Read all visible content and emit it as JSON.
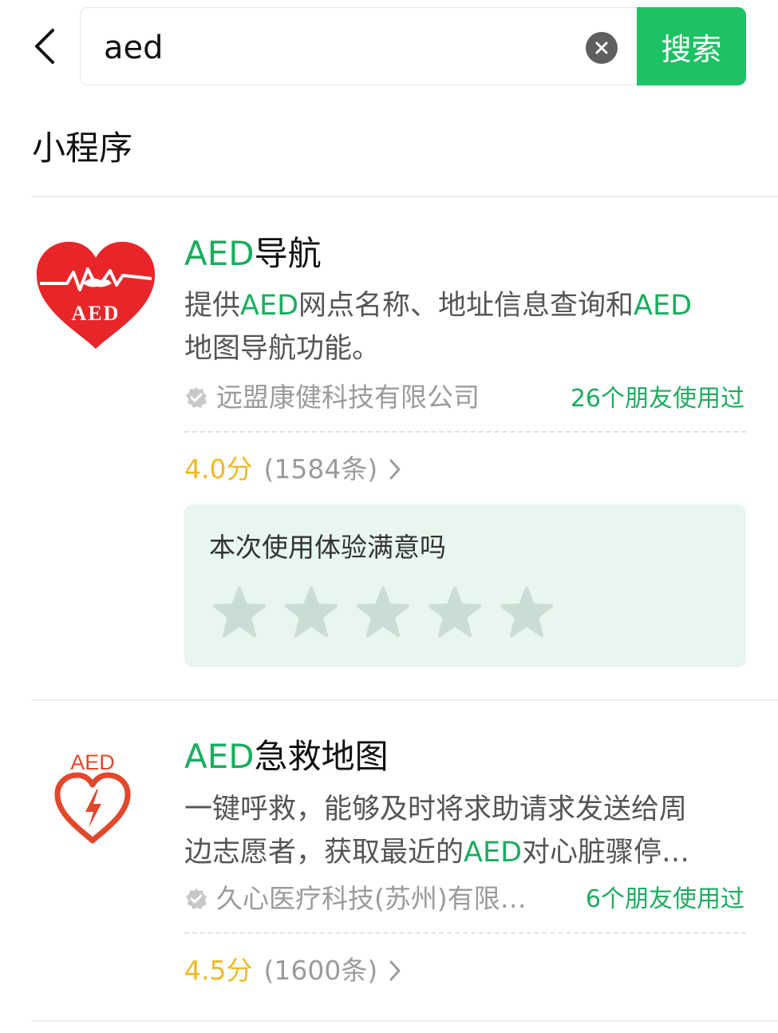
{
  "search": {
    "query": "aed",
    "button_label": "搜索"
  },
  "section": {
    "title": "小程序"
  },
  "results": [
    {
      "logo_text": "AED",
      "title_highlight": "AED",
      "title_rest": "导航",
      "desc_line1": [
        "提供",
        "AED",
        "网点名称、地址信息查询和",
        "AED"
      ],
      "desc_line2": "地图导航功能。",
      "developer": "远盟康健科技有限公司",
      "friends": "26个朋友使用过",
      "score": "4.0分",
      "count": "(1584条)"
    },
    {
      "logo_text": "AED",
      "title_highlight": "AED",
      "title_rest": "急救地图",
      "desc_line1": "一键呼救，能够及时将求助请求发送给周",
      "desc_line2": [
        "边志愿者，获取最近的",
        "AED",
        "对心脏骤停…"
      ],
      "developer": "久心医疗科技(苏州)有限…",
      "friends": "6个朋友使用过",
      "score": "4.5分",
      "count": "(1600条)"
    }
  ],
  "survey": {
    "question": "本次使用体验满意吗",
    "stars": 5
  },
  "colors": {
    "accent": "#1cc264",
    "highlight": "#1aad5e",
    "score": "#f2b824",
    "survey_bg": "#e7f6ee",
    "logo1": "#e8262a",
    "logo2": "#e1482c"
  }
}
